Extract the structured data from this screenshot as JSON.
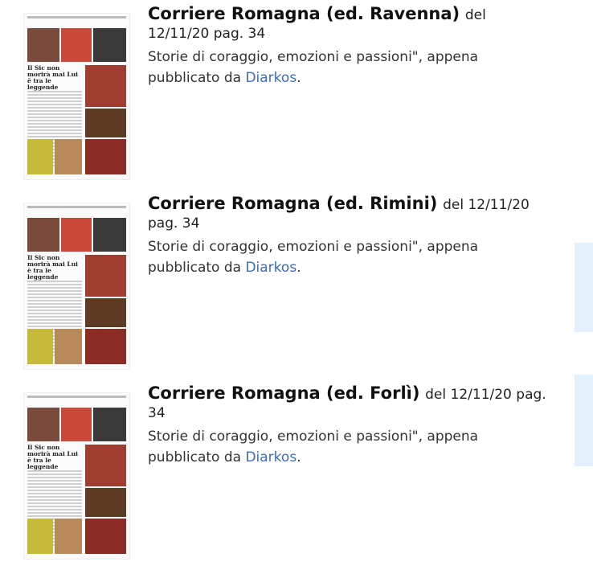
{
  "items": [
    {
      "title": "Corriere Romagna (ed. Ravenna)",
      "date": "del 12/11/20 pag. 34",
      "desc": "Storie di coraggio, emozioni e passioni\", appena pubblicato da",
      "link": "Diarkos",
      "period": ".",
      "thumb_headline": "Il Sic non morirà mai Lui è tra le leggende"
    },
    {
      "title": "Corriere Romagna (ed. Rimini)",
      "date": "del 12/11/20 pag. 34",
      "desc": "Storie di coraggio, emozioni e passioni\", appena pubblicato da",
      "link": "Diarkos",
      "period": ".",
      "thumb_headline": "Il Sic non morirà mai Lui è tra le leggende"
    },
    {
      "title": "Corriere Romagna (ed. Forlì)",
      "date": "del 12/11/20 pag. 34",
      "desc": "Storie di coraggio, emozioni e passioni\", appena pubblicato da",
      "link": "Diarkos",
      "period": ".",
      "thumb_headline": "Il Sic non morirà mai Lui è tra le leggende"
    }
  ]
}
